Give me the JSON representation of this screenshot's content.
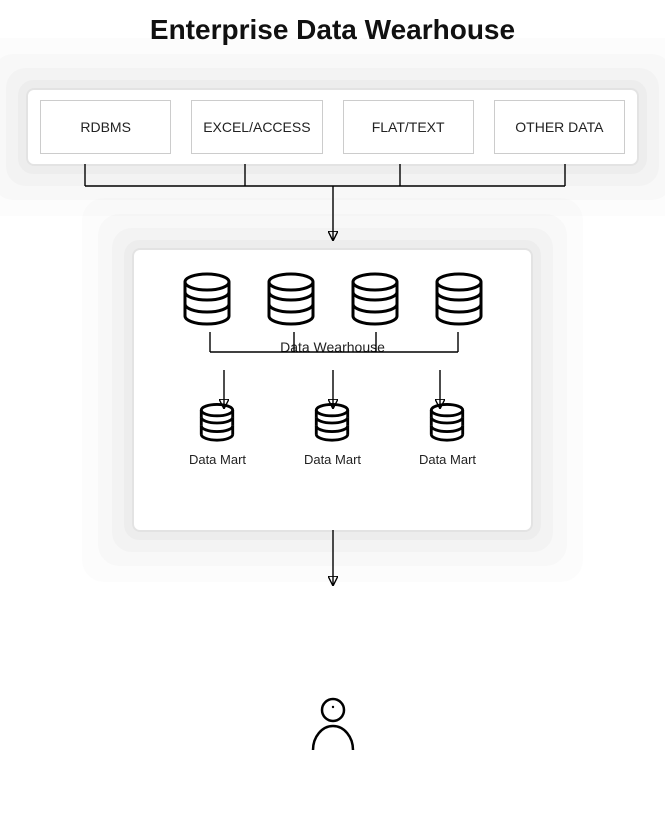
{
  "title": "Enterprise Data Wearhouse",
  "sources": {
    "rdbms": "RDBMS",
    "excel": "EXCEL/ACCESS",
    "flat": "FLAT/TEXT",
    "other": "OTHER DATA"
  },
  "warehouse": {
    "label": "Data Wearhouse",
    "mart_label_1": "Data Mart",
    "mart_label_2": "Data Mart",
    "mart_label_3": "Data Mart"
  }
}
